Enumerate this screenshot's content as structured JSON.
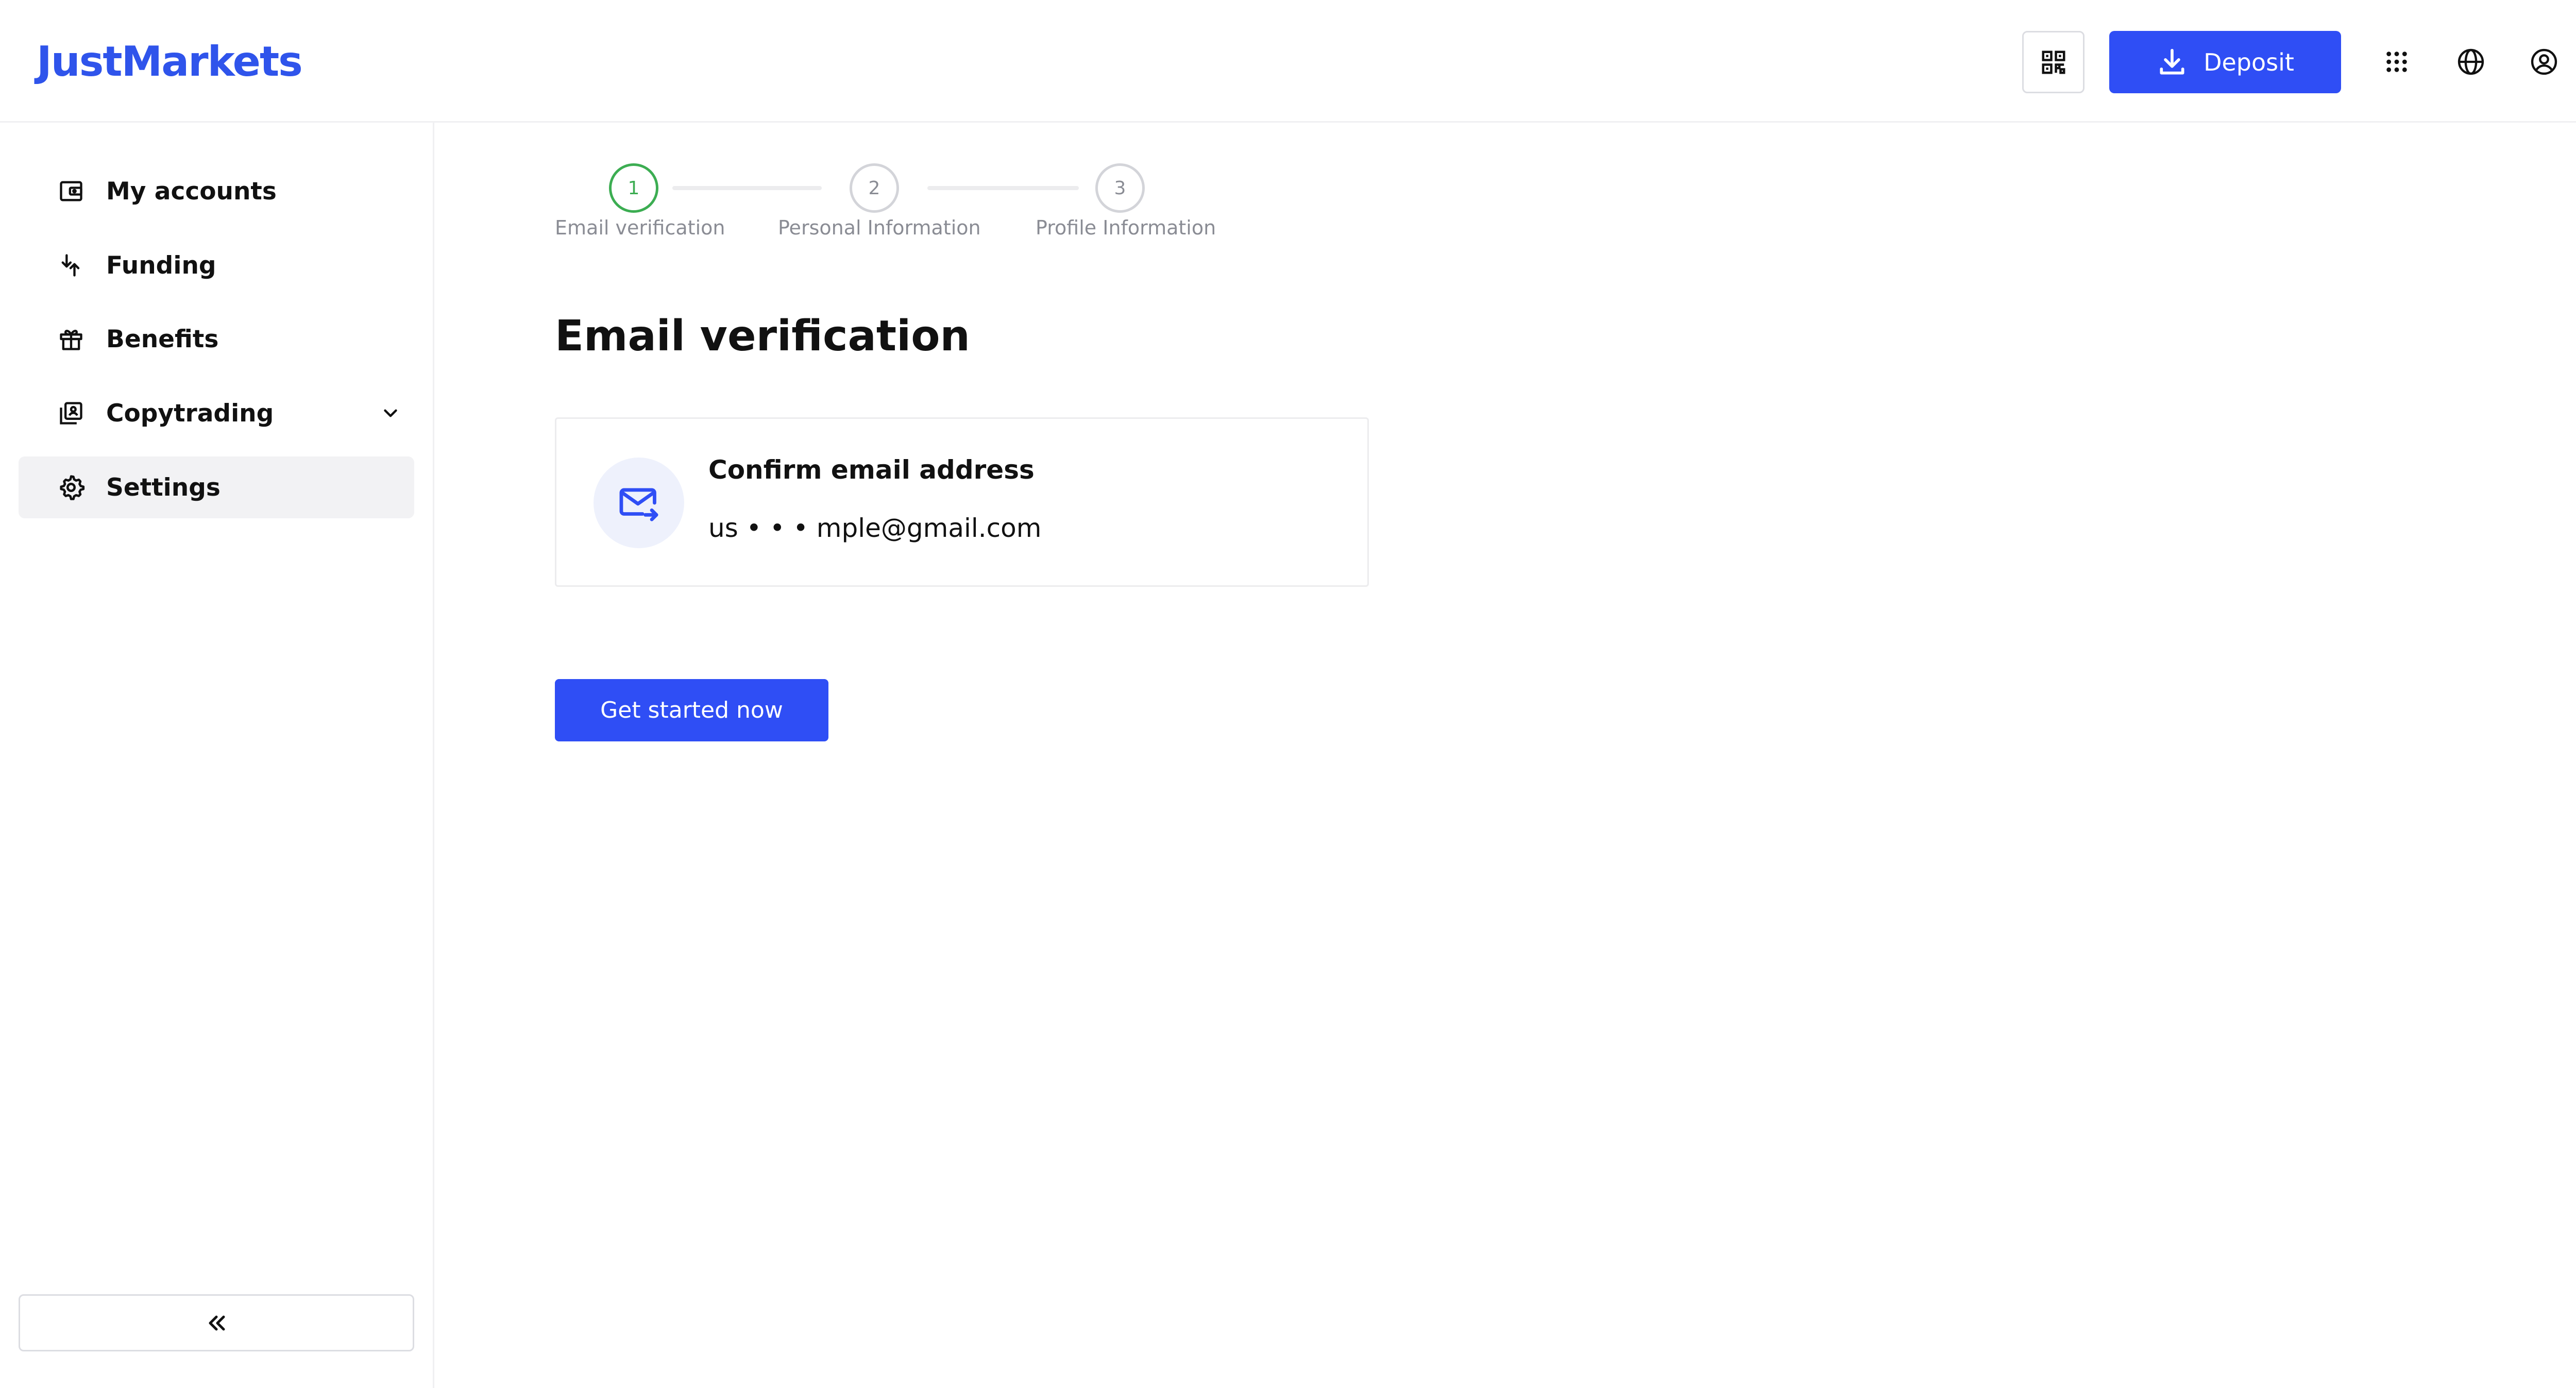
{
  "header": {
    "logo": "JustMarkets",
    "deposit_label": "Deposit",
    "icons": [
      "qr-code-icon",
      "download-icon",
      "apps-grid-icon",
      "globe-icon",
      "user-circle-icon"
    ]
  },
  "sidebar": {
    "items": [
      {
        "label": "My accounts",
        "icon": "wallet-icon"
      },
      {
        "label": "Funding",
        "icon": "arrows-transfer-icon"
      },
      {
        "label": "Benefits",
        "icon": "gift-icon"
      },
      {
        "label": "Copytrading",
        "icon": "copytrading-icon"
      },
      {
        "label": "Settings",
        "icon": "gear-icon"
      }
    ],
    "active": "Settings"
  },
  "stepper": {
    "steps": [
      {
        "number": "1",
        "label": "Email verification"
      },
      {
        "number": "2",
        "label": "Personal Information"
      },
      {
        "number": "3",
        "label": "Profile Information"
      }
    ],
    "current": "1"
  },
  "main": {
    "title": "Email verification",
    "card": {
      "title": "Confirm email address",
      "email": "us • • • mple@gmail.com"
    },
    "cta_label": "Get started now"
  },
  "colors": {
    "accent": "#2f4ef5",
    "logo": "#2f54eb",
    "step_active": "#3cad52",
    "icon_bg": "#eef1fc"
  }
}
